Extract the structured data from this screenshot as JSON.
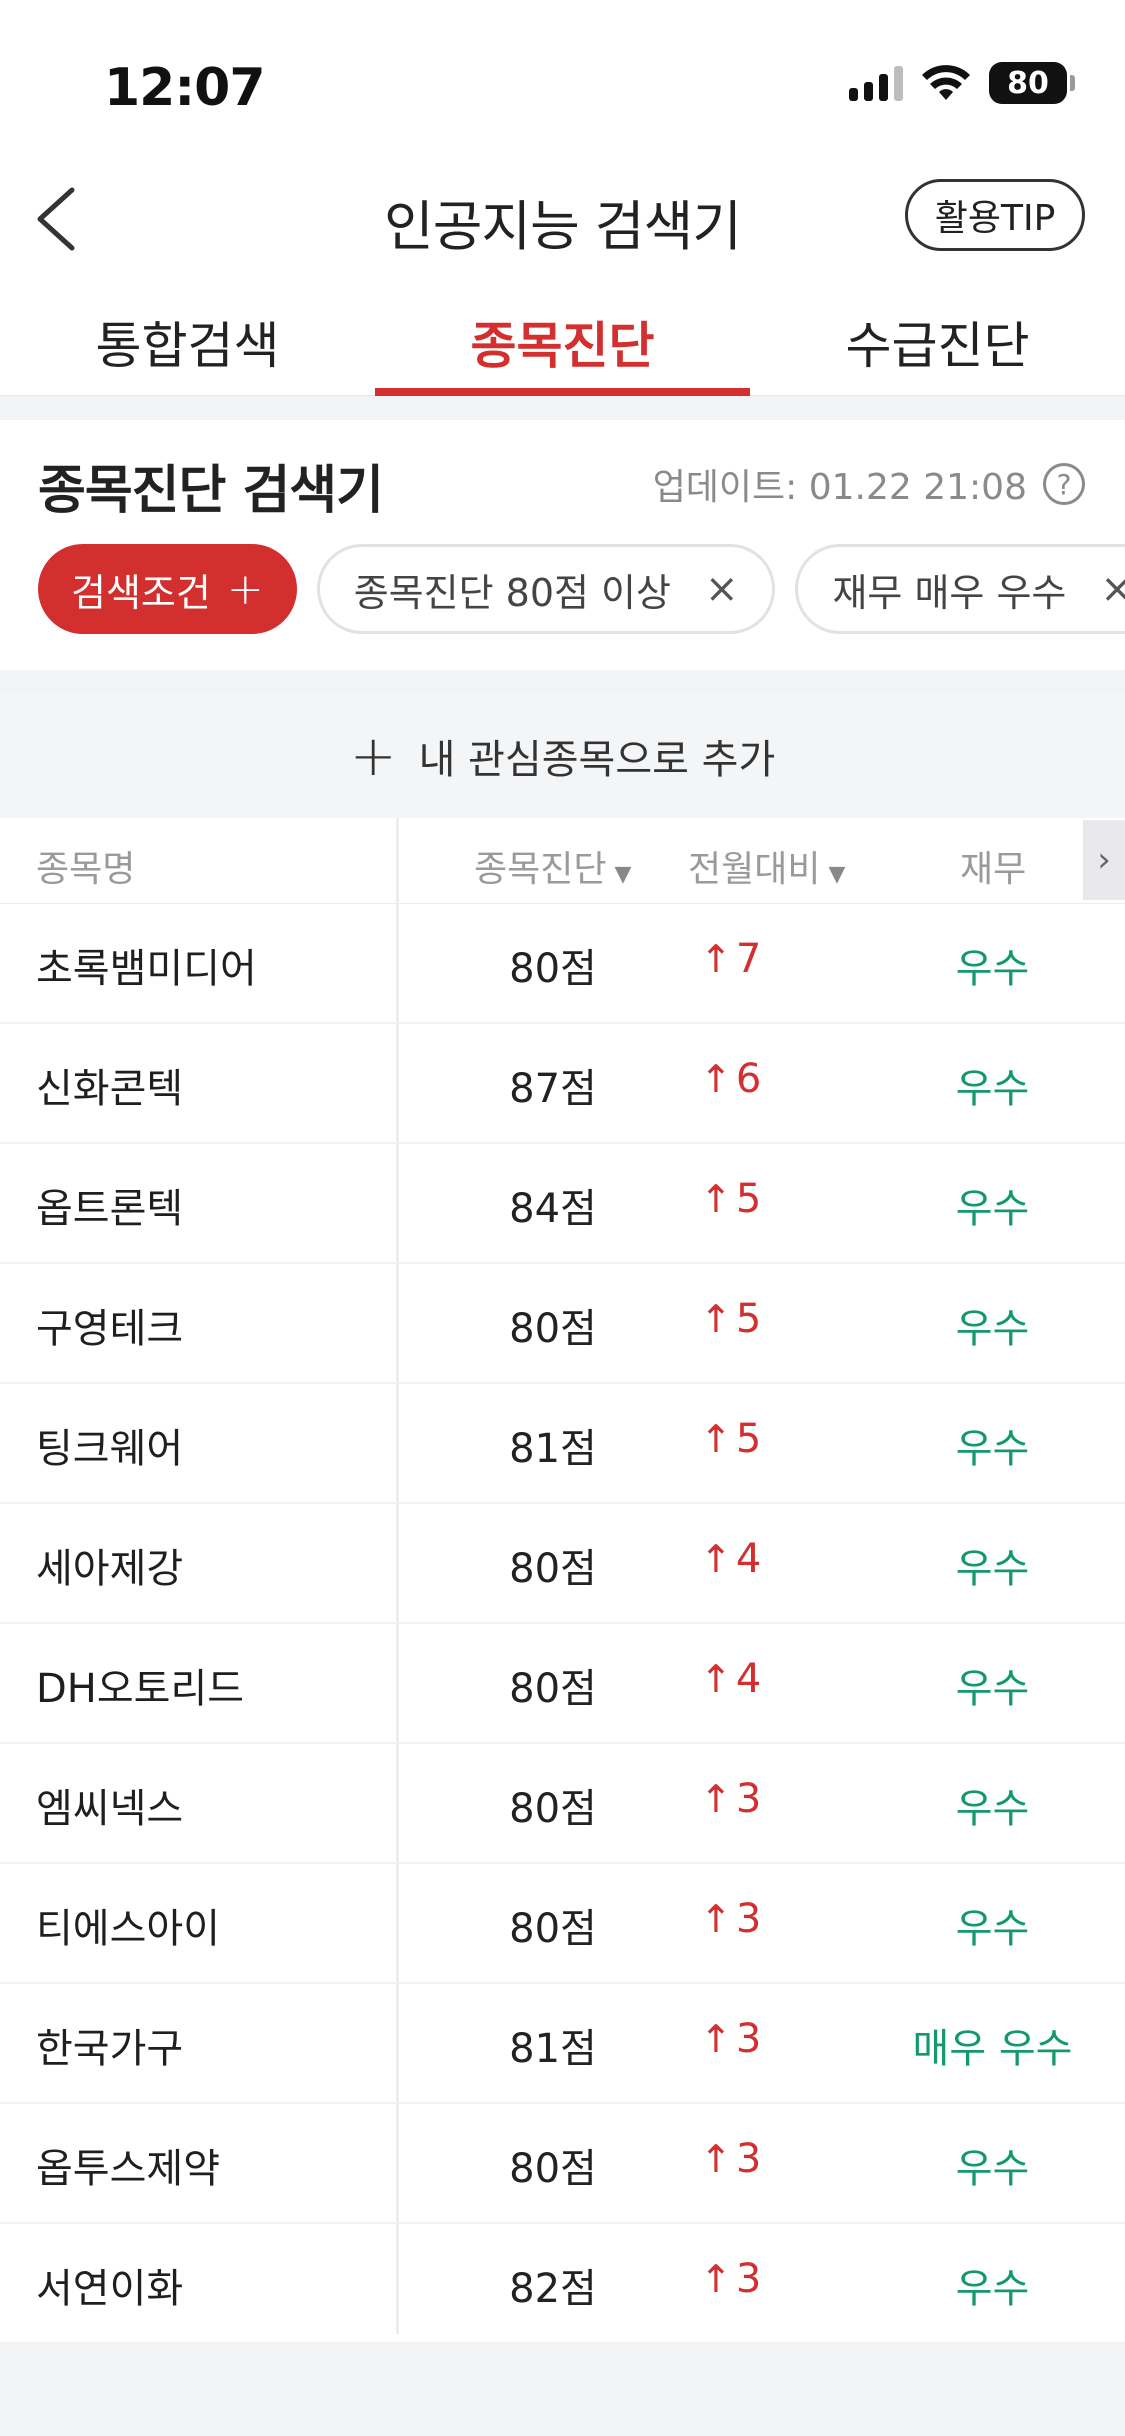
{
  "status_bar": {
    "time": "12:07",
    "battery": "80"
  },
  "nav": {
    "title": "인공지능 검색기",
    "tip_label": "활용TIP"
  },
  "tabs": [
    {
      "label": "통합검색"
    },
    {
      "label": "종목진단",
      "active": true
    },
    {
      "label": "수급진단"
    }
  ],
  "panel": {
    "title": "종목진단 검색기",
    "update_label": "업데이트: 01.22 21:08",
    "help_symbol": "?",
    "chips": [
      {
        "label": "검색조건",
        "icon": "+"
      },
      {
        "label": "종목진단 80점 이상",
        "icon": "×"
      },
      {
        "label": "재무 매우 우수",
        "icon": "×"
      }
    ]
  },
  "add_watch": {
    "icon": "+",
    "label": "내 관심종목으로 추가"
  },
  "table": {
    "headers": {
      "name": "종목명",
      "score": "종목진단",
      "change": "전월대비",
      "finance": "재무"
    },
    "rows": [
      {
        "name": "초록뱀미디어",
        "score": "80점",
        "change": "7",
        "finance": "우수"
      },
      {
        "name": "신화콘텍",
        "score": "87점",
        "change": "6",
        "finance": "우수"
      },
      {
        "name": "옵트론텍",
        "score": "84점",
        "change": "5",
        "finance": "우수"
      },
      {
        "name": "구영테크",
        "score": "80점",
        "change": "5",
        "finance": "우수"
      },
      {
        "name": "팅크웨어",
        "score": "81점",
        "change": "5",
        "finance": "우수"
      },
      {
        "name": "세아제강",
        "score": "80점",
        "change": "4",
        "finance": "우수"
      },
      {
        "name": "DH오토리드",
        "score": "80점",
        "change": "4",
        "finance": "우수"
      },
      {
        "name": "엠씨넥스",
        "score": "80점",
        "change": "3",
        "finance": "우수"
      },
      {
        "name": "티에스아이",
        "score": "80점",
        "change": "3",
        "finance": "우수"
      },
      {
        "name": "한국가구",
        "score": "81점",
        "change": "3",
        "finance": "매우 우수"
      },
      {
        "name": "옵투스제약",
        "score": "80점",
        "change": "3",
        "finance": "우수"
      },
      {
        "name": "서연이화",
        "score": "82점",
        "change": "3",
        "finance": "우수"
      }
    ]
  },
  "colors": {
    "accent": "#d32f2f",
    "good": "#14996a"
  }
}
